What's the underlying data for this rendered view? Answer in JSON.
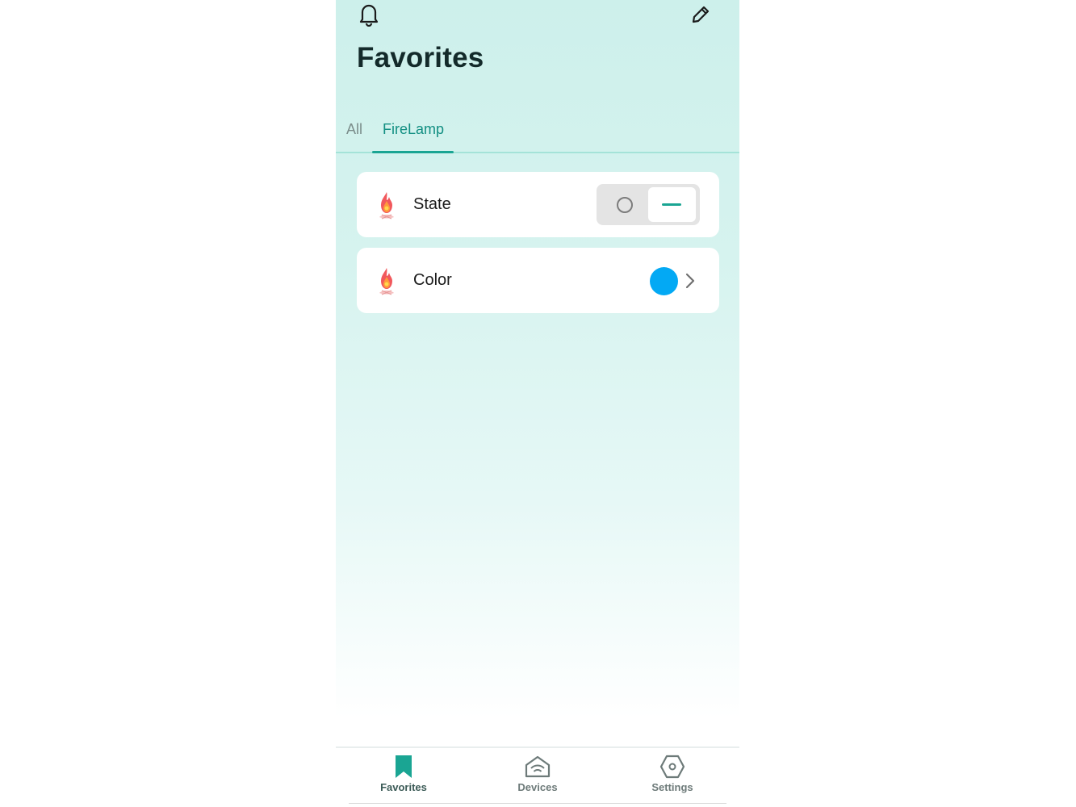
{
  "header": {
    "title": "Favorites",
    "icons": [
      "bell-icon",
      "pencil-icon"
    ]
  },
  "tabs": [
    {
      "label": "All",
      "active": false
    },
    {
      "label": "FireLamp",
      "active": true
    }
  ],
  "favorites": [
    {
      "label": "State",
      "icon": "flame-icon",
      "control": "toggle",
      "value": "on"
    },
    {
      "label": "Color",
      "icon": "flame-icon",
      "control": "color",
      "value": "#03a9f4"
    }
  ],
  "bottom_nav": [
    {
      "label": "Favorites",
      "icon": "bookmark-icon",
      "active": true
    },
    {
      "label": "Devices",
      "icon": "home-wifi-icon",
      "active": false
    },
    {
      "label": "Settings",
      "icon": "hexagon-settings-icon",
      "active": false
    }
  ],
  "colors": {
    "accent": "#1aa593",
    "selected_color": "#03a9f4"
  }
}
